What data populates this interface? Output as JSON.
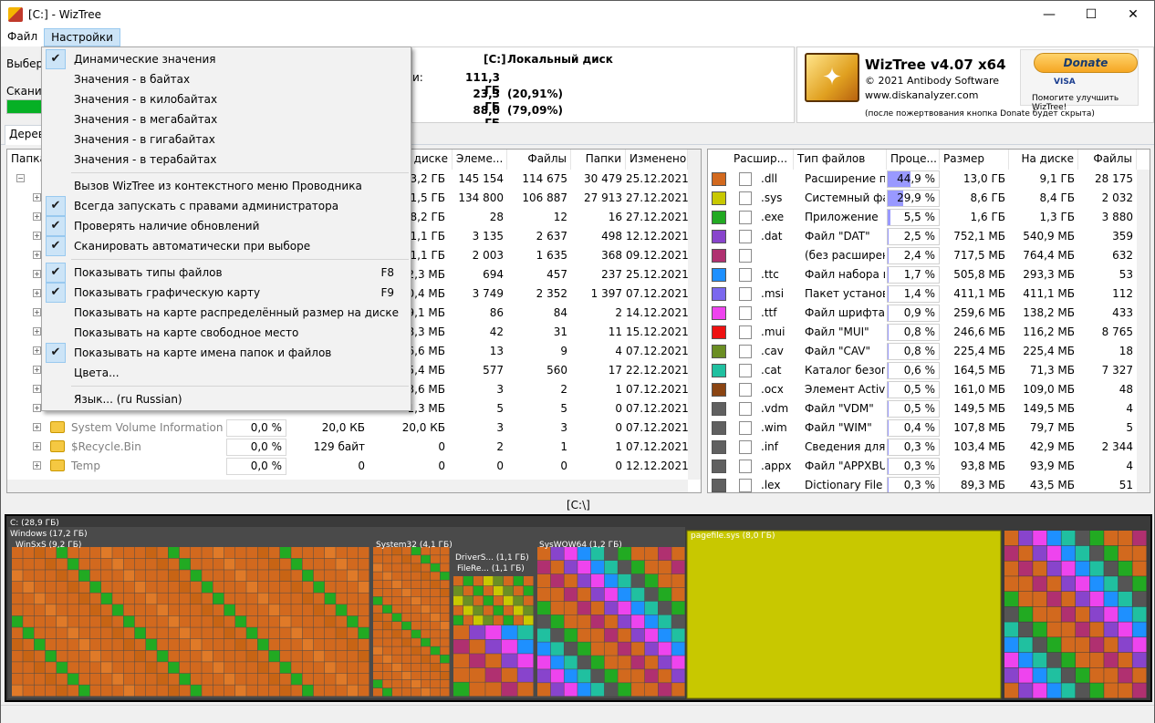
{
  "window": {
    "title": "[C:]  - WizTree",
    "minimize_glyph": "—",
    "maximize_glyph": "☐",
    "close_glyph": "✕"
  },
  "menubar": {
    "file": "Файл",
    "settings": "Настройки"
  },
  "toppanel": {
    "select_label": "Выбер",
    "scan_label": "Сканир",
    "progress": 1.0,
    "drive": {
      "name": "[C:]",
      "type": "Локальный диск",
      "total_label": "и:",
      "total": "111,3 ГБ",
      "used": "23,3 ГБ",
      "used_pct": "(20,91%)",
      "free": "88,0 ГБ",
      "free_pct": "(79,09%)"
    },
    "logo": {
      "product": "WizTree v4.07 x64",
      "copyright": "© 2021 Antibody Software",
      "site": "www.diskanalyzer.com",
      "donate_button": "Donate",
      "card_text": "VISA",
      "donate_help": "Помогите улучшить WizTree!",
      "donate_note": "(после пожертвования кнопка Donate будет скрыта)"
    }
  },
  "tabs": {
    "tree": "Дерев"
  },
  "tree": {
    "headers": {
      "folder": "Папка",
      "disk": "диске",
      "items": "Элеме...",
      "files": "Файлы",
      "folders": "Папки",
      "modified": "Изменено"
    },
    "rows": [
      {
        "name": "",
        "pct": "",
        "size": "",
        "disk": "23,2 ГБ",
        "items": "145 154",
        "files": "114 675",
        "folders": "30 479",
        "modified": "25.12.2021"
      },
      {
        "name": "",
        "pct": "",
        "size": "",
        "disk": "11,5 ГБ",
        "items": "134 800",
        "files": "106 887",
        "folders": "27 913",
        "modified": "27.12.2021"
      },
      {
        "name": "",
        "pct": "",
        "size": "",
        "disk": "8,2 ГБ",
        "items": "28",
        "files": "12",
        "folders": "16",
        "modified": "27.12.2021"
      },
      {
        "name": "",
        "pct": "",
        "size": "",
        "disk": "1,1 ГБ",
        "items": "3 135",
        "files": "2 637",
        "folders": "498",
        "modified": "12.12.2021"
      },
      {
        "name": "",
        "pct": "",
        "size": "",
        "disk": "1,1 ГБ",
        "items": "2 003",
        "files": "1 635",
        "folders": "368",
        "modified": "09.12.2021"
      },
      {
        "name": "",
        "pct": "",
        "size": "",
        "disk": "12,3 МБ",
        "items": "694",
        "files": "457",
        "folders": "237",
        "modified": "25.12.2021"
      },
      {
        "name": "",
        "pct": "",
        "size": "",
        "disk": "10,4 МБ",
        "items": "3 749",
        "files": "2 352",
        "folders": "1 397",
        "modified": "07.12.2021"
      },
      {
        "name": "",
        "pct": "",
        "size": "",
        "disk": "9,1 МБ",
        "items": "86",
        "files": "84",
        "folders": "2",
        "modified": "14.12.2021"
      },
      {
        "name": "",
        "pct": "",
        "size": "",
        "disk": "78,3 МБ",
        "items": "42",
        "files": "31",
        "folders": "11",
        "modified": "15.12.2021"
      },
      {
        "name": "",
        "pct": "",
        "size": "",
        "disk": "66,6 МБ",
        "items": "13",
        "files": "9",
        "folders": "4",
        "modified": "07.12.2021"
      },
      {
        "name": "",
        "pct": "",
        "size": "",
        "disk": "15,4 МБ",
        "items": "577",
        "files": "560",
        "folders": "17",
        "modified": "22.12.2021"
      },
      {
        "name": "",
        "pct": "",
        "size": "",
        "disk": "3,6 МБ",
        "items": "3",
        "files": "2",
        "folders": "1",
        "modified": "07.12.2021"
      },
      {
        "name": "",
        "pct": "",
        "size": "",
        "disk": "1,3 МБ",
        "items": "5",
        "files": "5",
        "folders": "0",
        "modified": "07.12.2021"
      },
      {
        "name": "System Volume Information",
        "pct": "0,0 %",
        "size": "20,0 КБ",
        "disk": "20,0 КБ",
        "items": "3",
        "files": "3",
        "folders": "0",
        "modified": "07.12.2021"
      },
      {
        "name": "$Recycle.Bin",
        "pct": "0,0 %",
        "size": "129 байт",
        "disk": "0",
        "items": "2",
        "files": "1",
        "folders": "1",
        "modified": "07.12.2021"
      },
      {
        "name": "Temp",
        "pct": "0,0 %",
        "size": "0",
        "disk": "0",
        "items": "0",
        "files": "0",
        "folders": "0",
        "modified": "12.12.2021"
      }
    ]
  },
  "ext": {
    "headers": {
      "ext": "Расшир...",
      "type": "Тип файлов",
      "pct": "Проце...",
      "size": "Размер",
      "disk": "На диске",
      "files": "Файлы"
    },
    "rows": [
      {
        "color": "#d2691e",
        "ext": ".dll",
        "type": "Расширение пр",
        "pct": "44,9 %",
        "frac": 0.449,
        "size": "13,0 ГБ",
        "disk": "9,1 ГБ",
        "files": "28 175"
      },
      {
        "color": "#c8c800",
        "ext": ".sys",
        "type": "Системный фай",
        "pct": "29,9 %",
        "frac": 0.299,
        "size": "8,6 ГБ",
        "disk": "8,4 ГБ",
        "files": "2 032"
      },
      {
        "color": "#22aa22",
        "ext": ".exe",
        "type": "Приложение",
        "pct": "5,5 %",
        "frac": 0.055,
        "size": "1,6 ГБ",
        "disk": "1,3 ГБ",
        "files": "3 880"
      },
      {
        "color": "#8844cc",
        "ext": ".dat",
        "type": "Файл \"DAT\"",
        "pct": "2,5 %",
        "frac": 0.025,
        "size": "752,1 МБ",
        "disk": "540,9 МБ",
        "files": "359"
      },
      {
        "color": "#b03070",
        "ext": "",
        "type": "(без расширен",
        "pct": "2,4 %",
        "frac": 0.024,
        "size": "717,5 МБ",
        "disk": "764,4 МБ",
        "files": "632"
      },
      {
        "color": "#1e90ff",
        "ext": ".ttc",
        "type": "Файл набора ш",
        "pct": "1,7 %",
        "frac": 0.017,
        "size": "505,8 МБ",
        "disk": "293,3 МБ",
        "files": "53"
      },
      {
        "color": "#7b68ee",
        "ext": ".msi",
        "type": "Пакет установ",
        "pct": "1,4 %",
        "frac": 0.014,
        "size": "411,1 МБ",
        "disk": "411,1 МБ",
        "files": "112"
      },
      {
        "color": "#ee44ee",
        "ext": ".ttf",
        "type": "Файл шрифта T",
        "pct": "0,9 %",
        "frac": 0.009,
        "size": "259,6 МБ",
        "disk": "138,2 МБ",
        "files": "433"
      },
      {
        "color": "#ee1111",
        "ext": ".mui",
        "type": "Файл \"MUI\"",
        "pct": "0,8 %",
        "frac": 0.008,
        "size": "246,6 МБ",
        "disk": "116,2 МБ",
        "files": "8 765"
      },
      {
        "color": "#6b8e23",
        "ext": ".cav",
        "type": "Файл \"CAV\"",
        "pct": "0,8 %",
        "frac": 0.008,
        "size": "225,4 МБ",
        "disk": "225,4 МБ",
        "files": "18"
      },
      {
        "color": "#20c0a0",
        "ext": ".cat",
        "type": "Каталог безопа",
        "pct": "0,6 %",
        "frac": 0.006,
        "size": "164,5 МБ",
        "disk": "71,3 МБ",
        "files": "7 327"
      },
      {
        "color": "#8b4513",
        "ext": ".ocx",
        "type": "Элемент ActiveX",
        "pct": "0,5 %",
        "frac": 0.005,
        "size": "161,0 МБ",
        "disk": "109,0 МБ",
        "files": "48"
      },
      {
        "color": "#606060",
        "ext": ".vdm",
        "type": "Файл \"VDM\"",
        "pct": "0,5 %",
        "frac": 0.005,
        "size": "149,5 МБ",
        "disk": "149,5 МБ",
        "files": "4"
      },
      {
        "color": "#606060",
        "ext": ".wim",
        "type": "Файл \"WIM\"",
        "pct": "0,4 %",
        "frac": 0.004,
        "size": "107,8 МБ",
        "disk": "79,7 МБ",
        "files": "5"
      },
      {
        "color": "#606060",
        "ext": ".inf",
        "type": "Сведения для ус",
        "pct": "0,3 %",
        "frac": 0.003,
        "size": "103,4 МБ",
        "disk": "42,9 МБ",
        "files": "2 344"
      },
      {
        "color": "#606060",
        "ext": ".appx",
        "type": "Файл \"APPXBUN",
        "pct": "0,3 %",
        "frac": 0.003,
        "size": "93,8 МБ",
        "disk": "93,9 МБ",
        "files": "4"
      },
      {
        "color": "#606060",
        "ext": ".lex",
        "type": "Dictionary File",
        "pct": "0,3 %",
        "frac": 0.003,
        "size": "89,3 МБ",
        "disk": "43,5 МБ",
        "files": "51"
      }
    ]
  },
  "map": {
    "path": "[C:\\]",
    "labels": {
      "root": "C: (28,9 ГБ)",
      "windows": "Windows (17,2 ГБ)",
      "winsxs": "WinSxS (9,2 ГБ)",
      "system32": "System32 (4,1 ГБ)",
      "driverstore": "DriverS... (1,1 ГБ)",
      "filerepository": "FileRe... (1,1 ГБ)",
      "syswow64": "SysWOW64 (1,2 ГБ)",
      "pagefile": "pagefile.sys (8,0 ГБ)"
    },
    "colors": {
      "dll": "#d2691e",
      "sys": "#c8c800",
      "exe": "#22aa22"
    }
  },
  "dropdown": {
    "items": [
      {
        "label": "Динамические значения",
        "checked": true,
        "shortcut": ""
      },
      {
        "label": "Значения - в байтах",
        "checked": false,
        "shortcut": ""
      },
      {
        "label": "Значения - в килобайтах",
        "checked": false,
        "shortcut": ""
      },
      {
        "label": "Значения - в мегабайтах",
        "checked": false,
        "shortcut": ""
      },
      {
        "label": "Значения - в гигабайтах",
        "checked": false,
        "shortcut": ""
      },
      {
        "label": "Значения - в терабайтах",
        "checked": false,
        "shortcut": ""
      },
      {
        "label": "Вызов WizTree из контекстного меню Проводника",
        "checked": false,
        "shortcut": ""
      },
      {
        "label": "Всегда запускать с правами администратора",
        "checked": true,
        "shortcut": ""
      },
      {
        "label": "Проверять наличие обновлений",
        "checked": true,
        "shortcut": ""
      },
      {
        "label": "Сканировать автоматически при выборе",
        "checked": true,
        "shortcut": ""
      },
      {
        "label": "Показывать типы файлов",
        "checked": true,
        "shortcut": "F8"
      },
      {
        "label": "Показывать графическую карту",
        "checked": true,
        "shortcut": "F9"
      },
      {
        "label": "Показывать на карте распределённый размер на диске",
        "checked": false,
        "shortcut": ""
      },
      {
        "label": "Показывать на карте свободное место",
        "checked": false,
        "shortcut": ""
      },
      {
        "label": "Показывать на карте имена папок и файлов",
        "checked": true,
        "shortcut": ""
      },
      {
        "label": "Цвета...",
        "checked": false,
        "shortcut": ""
      },
      {
        "label": "Язык... (ru Russian)",
        "checked": false,
        "shortcut": ""
      }
    ],
    "check_glyph": "✔"
  }
}
